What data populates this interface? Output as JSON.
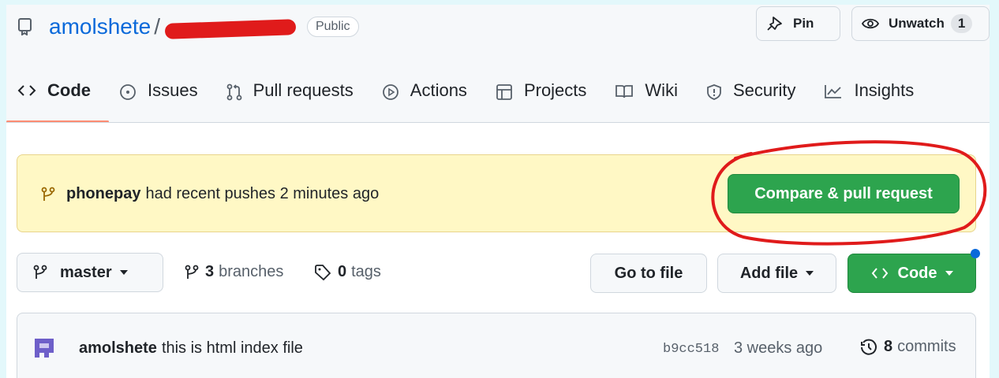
{
  "repo": {
    "owner": "amolshete",
    "separator": "/",
    "visibility": "Public"
  },
  "header_buttons": {
    "pin": "Pin",
    "unwatch": "Unwatch",
    "watch_count": "1"
  },
  "tabs": [
    {
      "label": "Code",
      "icon": "code-icon",
      "selected": true
    },
    {
      "label": "Issues",
      "icon": "issue-icon"
    },
    {
      "label": "Pull requests",
      "icon": "pull-request-icon"
    },
    {
      "label": "Actions",
      "icon": "play-icon"
    },
    {
      "label": "Projects",
      "icon": "table-icon"
    },
    {
      "label": "Wiki",
      "icon": "book-icon"
    },
    {
      "label": "Security",
      "icon": "shield-icon"
    },
    {
      "label": "Insights",
      "icon": "graph-icon"
    }
  ],
  "banner": {
    "branch": "phonepay",
    "text": "had recent pushes 2 minutes ago",
    "button": "Compare & pull request"
  },
  "branch_bar": {
    "branch": "master",
    "branches_count": "3",
    "branches_label": "branches",
    "tags_count": "0",
    "tags_label": "tags",
    "go_to_file": "Go to file",
    "add_file": "Add file",
    "code": "Code"
  },
  "commit": {
    "author": "amolshete",
    "message": "this is html index file",
    "sha": "b9cc518",
    "time": "3 weeks ago",
    "commit_count": "8",
    "commits_label": "commits"
  },
  "colors": {
    "accent_green": "#2da44e",
    "link_blue": "#0969da",
    "banner_yellow": "#fff8c5",
    "annotation_red": "#e01b1b",
    "tab_underline": "#fd8c73"
  }
}
